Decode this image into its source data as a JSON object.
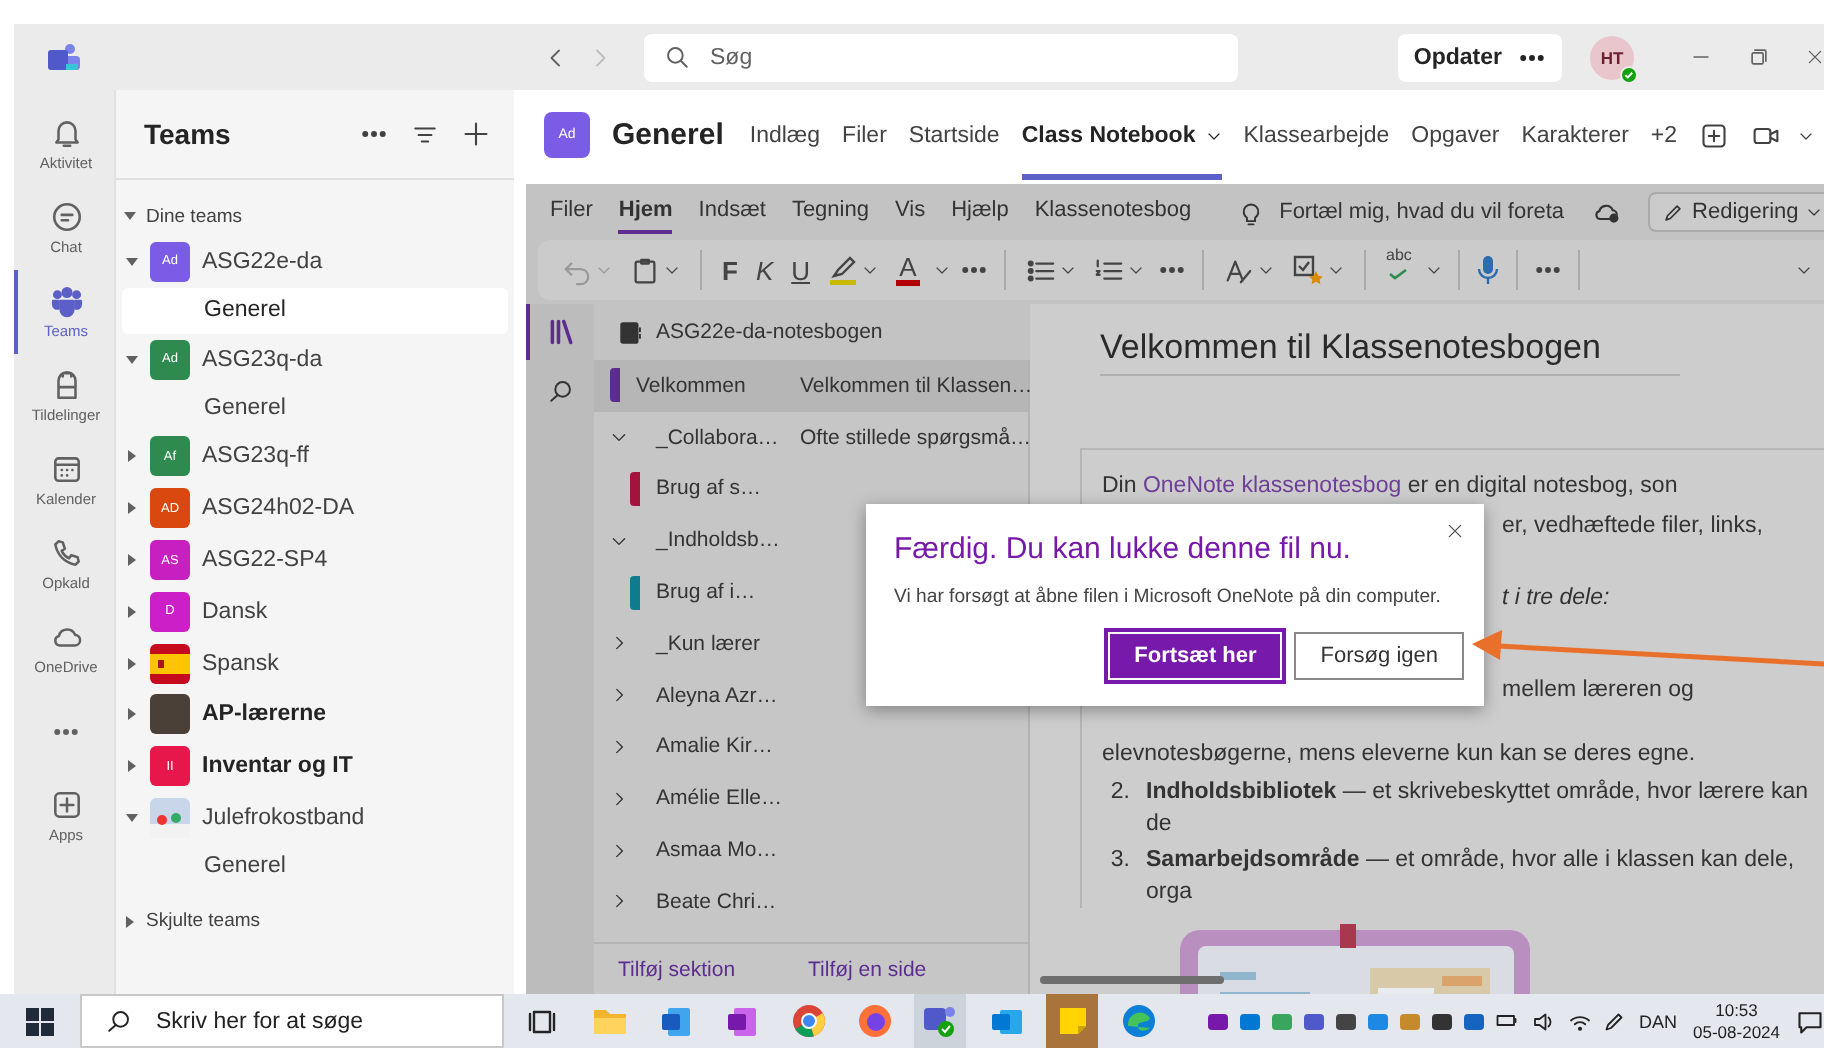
{
  "titlebar": {
    "back_disabled": false,
    "forward_disabled": true,
    "search": {
      "placeholder": "Søg"
    },
    "update_button": "Opdater",
    "avatar": "HT",
    "online": true
  },
  "rail": [
    {
      "kind": "app",
      "label": "Aktivitet",
      "selected": false
    },
    {
      "kind": "app",
      "label": "Chat",
      "selected": false
    },
    {
      "kind": "app",
      "label": "Teams",
      "selected": true
    },
    {
      "kind": "app",
      "label": "Tildelinger",
      "selected": false
    },
    {
      "kind": "app",
      "label": "Kalender",
      "selected": false
    },
    {
      "kind": "app",
      "label": "Opkald",
      "selected": false
    },
    {
      "kind": "app",
      "label": "OneDrive",
      "selected": false
    },
    {
      "kind": "more",
      "selected": false
    },
    {
      "kind": "app",
      "label": "Apps",
      "selected": false
    }
  ],
  "teams_panel": {
    "title": "Teams",
    "section": "Dine teams",
    "teams": [
      {
        "name": "ASG22e-da",
        "kind": "initials",
        "initials": "Ad",
        "color": "#7b5ce6",
        "expanded": true,
        "unread": false,
        "channels": [
          {
            "name": "Generel",
            "selected": true
          }
        ]
      },
      {
        "name": "ASG23q-da",
        "kind": "initials",
        "initials": "Ad",
        "color": "#2e8a4f",
        "expanded": true,
        "unread": false,
        "channels": [
          {
            "name": "Generel",
            "selected": false
          }
        ]
      },
      {
        "name": "ASG23q-ff",
        "kind": "initials",
        "initials": "Af",
        "color": "#2e8a4f",
        "expanded": false,
        "unread": false
      },
      {
        "name": "ASG24h02-DA",
        "kind": "initials",
        "initials": "AD",
        "color": "#d9480f",
        "expanded": false,
        "unread": false
      },
      {
        "name": "ASG22-SP4",
        "kind": "initials",
        "initials": "AS",
        "color": "#c71fc0",
        "expanded": false,
        "unread": false
      },
      {
        "name": "Dansk",
        "kind": "initials",
        "initials": "D",
        "color": "#cc1fc7",
        "expanded": false,
        "unread": false
      },
      {
        "name": "Spansk",
        "kind": "flag",
        "expanded": false,
        "unread": false
      },
      {
        "name": "AP-lærerne",
        "kind": "photo",
        "expanded": false,
        "unread": true
      },
      {
        "name": "Inventar og IT",
        "kind": "initials",
        "initials": "II",
        "color": "#e8174b",
        "expanded": false,
        "unread": true
      },
      {
        "name": "Julefrokostband",
        "kind": "picture",
        "expanded": true,
        "unread": false,
        "channels": [
          {
            "name": "Generel",
            "selected": false
          }
        ]
      }
    ],
    "hidden_teams": "Skjulte teams"
  },
  "channel": {
    "avatar": "Ad",
    "title": "Generel",
    "tabs": [
      {
        "label": "Indlæg",
        "selected": false
      },
      {
        "label": "Filer",
        "selected": false
      },
      {
        "label": "Startside",
        "selected": false
      },
      {
        "label": "Class Notebook",
        "selected": true
      },
      {
        "label": "Klassearbejde",
        "selected": false
      },
      {
        "label": "Opgaver",
        "selected": false
      },
      {
        "label": "Karakterer",
        "selected": false
      }
    ],
    "overflow": "+2"
  },
  "onenote": {
    "menu": [
      {
        "label": "Filer",
        "selected": false
      },
      {
        "label": "Hjem",
        "selected": true
      },
      {
        "label": "Indsæt",
        "selected": false
      },
      {
        "label": "Tegning",
        "selected": false
      },
      {
        "label": "Vis",
        "selected": false
      },
      {
        "label": "Hjælp",
        "selected": false
      },
      {
        "label": "Klassenotesbog",
        "selected": false
      }
    ],
    "tell_me": "Fortæl mig, hvad du vil foreta",
    "mode_button": "Redigering",
    "ribbon": {
      "undo_disabled": true,
      "bold": "F",
      "italic": "K",
      "underline": "U",
      "font_color": "A",
      "spelling": "abc"
    },
    "notebook": "ASG22e-da-notesbogen",
    "sections": [
      {
        "kind": "section",
        "label": "Velkommen",
        "color": "#5c2d91",
        "selected": true
      },
      {
        "kind": "group",
        "label": "_Collabora…",
        "expanded": true,
        "children": [
          {
            "kind": "section",
            "label": "Brug af s…",
            "color": "#a4133c",
            "selected": false
          }
        ]
      },
      {
        "kind": "group",
        "label": "_Indholdsb…",
        "expanded": true,
        "children": [
          {
            "kind": "section",
            "label": "Brug af i…",
            "color": "#0f7b8f",
            "selected": false
          }
        ]
      },
      {
        "kind": "group",
        "label": "_Kun lærer",
        "expanded": false
      },
      {
        "kind": "group",
        "label": "Aleyna Azr…",
        "expanded": false
      },
      {
        "kind": "group",
        "label": "Amalie Kir…",
        "expanded": false
      },
      {
        "kind": "group",
        "label": "Amélie Elle…",
        "expanded": false
      },
      {
        "kind": "group",
        "label": "Asmaa Mo…",
        "expanded": false
      },
      {
        "kind": "group",
        "label": "Beate Chri…",
        "expanded": false
      }
    ],
    "pages": [
      {
        "title": "Velkommen til Klassen…",
        "selected": true
      },
      {
        "title": "Ofte stillede spørgsmå…",
        "selected": false
      }
    ],
    "add_section": "Tilføj sektion",
    "add_page": "Tilføj en side",
    "page": {
      "title": "Velkommen til Klassenotesbogen",
      "blocks": [
        {
          "kind": "paragraph",
          "before": "Din",
          "link": "OneNote klassenotesbog",
          "after": "er en digital notesbog, son"
        },
        {
          "kind": "fragment",
          "text": "er, vedhæftede filer, links,",
          "italic": false
        },
        {
          "kind": "fragment",
          "text": "t i tre dele:",
          "italic": true
        },
        {
          "kind": "fragment",
          "text": "mellem læreren og",
          "italic": false
        },
        {
          "kind": "line",
          "text": "elevnotesbøgerne, mens eleverne kun kan se deres egne."
        },
        {
          "kind": "numbered",
          "number": "2.",
          "text": "**Indholdsbibliotek** — et skrivebeskyttet område, hvor lærere kan de"
        },
        {
          "kind": "numbered",
          "number": "3.",
          "text": "**Samarbejdsområde** — et område, hvor alle i klassen kan dele, orga"
        }
      ]
    },
    "dialog": {
      "title": "Færdig. Du kan lukke denne fil nu.",
      "message": "Vi har forsøgt at åbne filen i Microsoft OneNote på din computer.",
      "buttons": [
        {
          "label": "Fortsæt her",
          "kind": "primary"
        },
        {
          "label": "Forsøg igen",
          "kind": "secondary"
        }
      ]
    }
  },
  "taskbar": {
    "search": {
      "placeholder": "Skriv her for at søge"
    },
    "language": "DAN",
    "time": "10:53",
    "date": "05-08-2024"
  }
}
